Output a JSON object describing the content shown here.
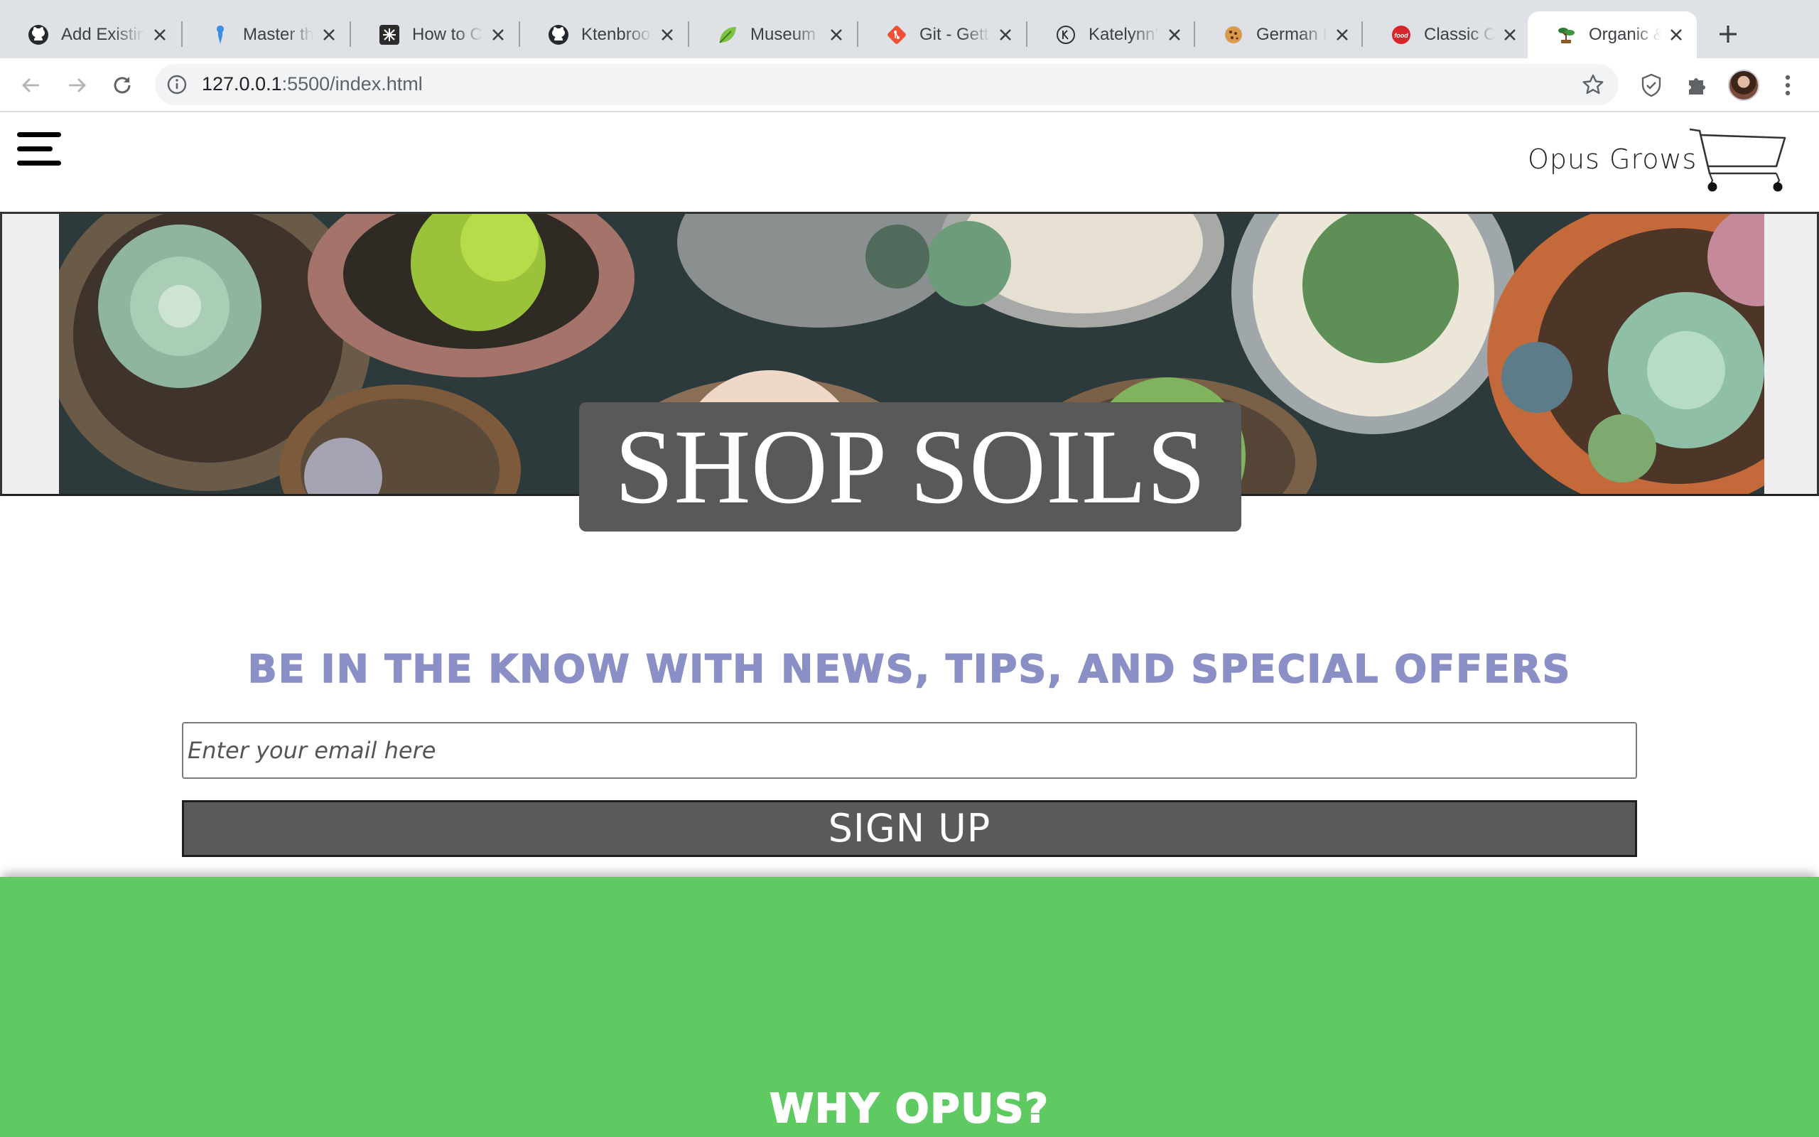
{
  "browser": {
    "tabs": [
      {
        "title": "Add Existing Project to GitHub",
        "icon": "github-icon"
      },
      {
        "title": "Master the Basics",
        "icon": "pin-icon"
      },
      {
        "title": "How to Code",
        "icon": "codepen-icon"
      },
      {
        "title": "Ktenbrook",
        "icon": "github-icon"
      },
      {
        "title": "Museum of",
        "icon": "leaf-icon"
      },
      {
        "title": "Git - Getting Started",
        "icon": "git-icon"
      },
      {
        "title": "Katelynn's",
        "icon": "k-circle-icon"
      },
      {
        "title": "German Pancakes",
        "icon": "cookie-icon"
      },
      {
        "title": "Classic Chocolate",
        "icon": "food-network-icon"
      },
      {
        "title": "Organic & Natural Soils",
        "icon": "bonsai-icon"
      }
    ],
    "active_tab_index": 9,
    "url_host": "127.0.0.1",
    "url_rest": ":5500/index.html"
  },
  "site": {
    "brand": "Opus Grows",
    "hero_title": "SHOP SOILS",
    "newsletter_heading": "Be in the know with news, tips, and special offers",
    "email_placeholder": "Enter your email here",
    "signup_label": "SIGN UP",
    "why_heading": "Why Opus?"
  },
  "colors": {
    "accent_periwinkle": "#8a8fc5",
    "section_green": "#5fc962",
    "hero_label_bg": "#595959",
    "button_bg": "#5a5a5a"
  }
}
